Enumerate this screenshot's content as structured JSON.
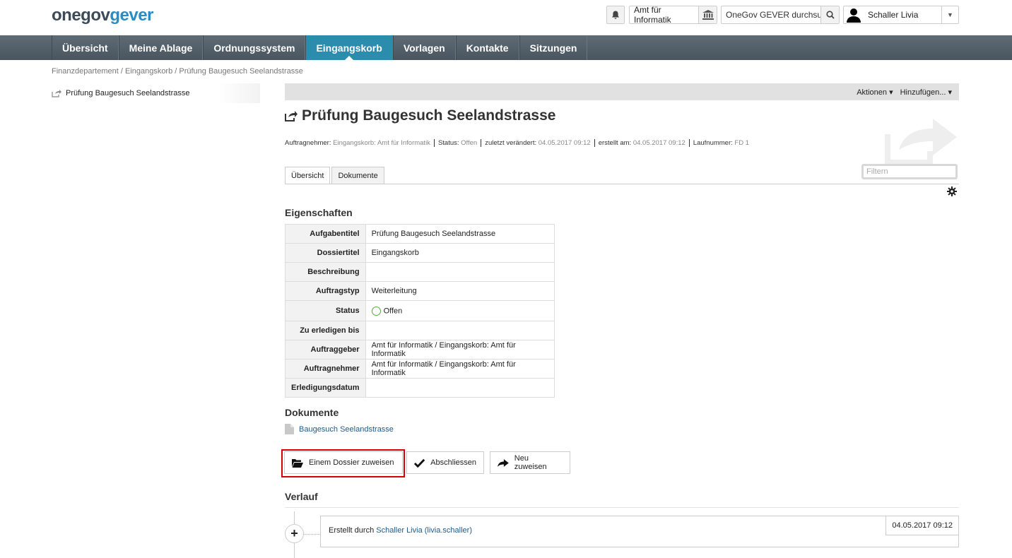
{
  "brand": {
    "part1": "one",
    "part2": "gov",
    "part3": "gever"
  },
  "header": {
    "org_label": "Amt für Informatik",
    "search_placeholder": "OneGov GEVER durchsuc",
    "user_name": "Schaller Livia"
  },
  "nav": {
    "items": [
      {
        "label": "Übersicht"
      },
      {
        "label": "Meine Ablage"
      },
      {
        "label": "Ordnungssystem"
      },
      {
        "label": "Eingangskorb"
      },
      {
        "label": "Vorlagen"
      },
      {
        "label": "Kontakte"
      },
      {
        "label": "Sitzungen"
      }
    ],
    "active": "Eingangskorb"
  },
  "breadcrumb": "Finanzdepartement / Eingangskorb / Prüfung Baugesuch Seelandstrasse",
  "tree": {
    "item": "Prüfung Baugesuch Seelandstrasse"
  },
  "actionbar": {
    "actions": "Aktionen ▾",
    "add": "Hinzufügen... ▾"
  },
  "title": "Prüfung Baugesuch Seelandstrasse",
  "meta": [
    {
      "k": "Auftragnehmer:",
      "v": "Eingangskorb: Amt für Informatik"
    },
    {
      "k": "Status:",
      "v": "Offen"
    },
    {
      "k": "zuletzt verändert:",
      "v": "04.05.2017 09:12"
    },
    {
      "k": "erstellt am:",
      "v": "04.05.2017 09:12"
    },
    {
      "k": "Laufnummer:",
      "v": "FD 1"
    }
  ],
  "tabs": [
    {
      "label": "Übersicht"
    },
    {
      "label": "Dokumente"
    }
  ],
  "filter_placeholder": "Filtern",
  "properties": {
    "heading": "Eigenschaften",
    "rows": [
      {
        "k": "Aufgabentitel",
        "v": "Prüfung Baugesuch Seelandstrasse"
      },
      {
        "k": "Dossiertitel",
        "v": "Eingangskorb"
      },
      {
        "k": "Beschreibung",
        "v": ""
      },
      {
        "k": "Auftragstyp",
        "v": "Weiterleitung"
      },
      {
        "k": "Status",
        "v": "Offen"
      },
      {
        "k": "Zu erledigen bis",
        "v": ""
      },
      {
        "k": "Auftraggeber",
        "v": "Amt für Informatik / Eingangskorb: Amt für Informatik"
      },
      {
        "k": "Auftragnehmer",
        "v": "Amt für Informatik / Eingangskorb: Amt für Informatik"
      },
      {
        "k": "Erledigungsdatum",
        "v": ""
      }
    ]
  },
  "documents": {
    "heading": "Dokumente",
    "items": [
      {
        "label": "Baugesuch Seelandstrasse"
      }
    ]
  },
  "buttons": {
    "assign": "Einem Dossier zuweisen",
    "close": "Abschliessen",
    "reassign": "Neu zuweisen"
  },
  "history": {
    "heading": "Verlauf",
    "entry_prefix": "Erstellt durch",
    "entry_user": "Schaller Livia (livia.schaller)",
    "entry_date": "04.05.2017 09:12"
  },
  "colors": {
    "nav_active": "#2b8cad",
    "link": "#1f5a8c",
    "highlight": "#d60000"
  }
}
